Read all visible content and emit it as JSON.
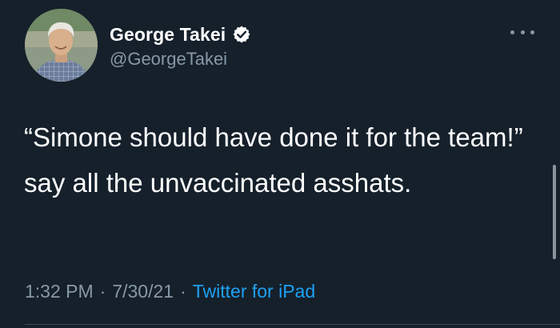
{
  "tweet": {
    "author": {
      "display_name": "George Takei",
      "handle": "@GeorgeTakei",
      "verified": true
    },
    "text": "“Simone should have done it for the team!” say all the unvaccinated asshats.",
    "time": "1:32 PM",
    "separator": "·",
    "date": "7/30/21",
    "source": "Twitter for iPad"
  },
  "colors": {
    "background": "#15202b",
    "primary_text": "#ffffff",
    "secondary_text": "#8899a6",
    "link": "#1da1f2",
    "verified_badge": "#ffffff"
  },
  "icons": {
    "verified": "verified-badge-icon",
    "more": "more-options-icon"
  }
}
